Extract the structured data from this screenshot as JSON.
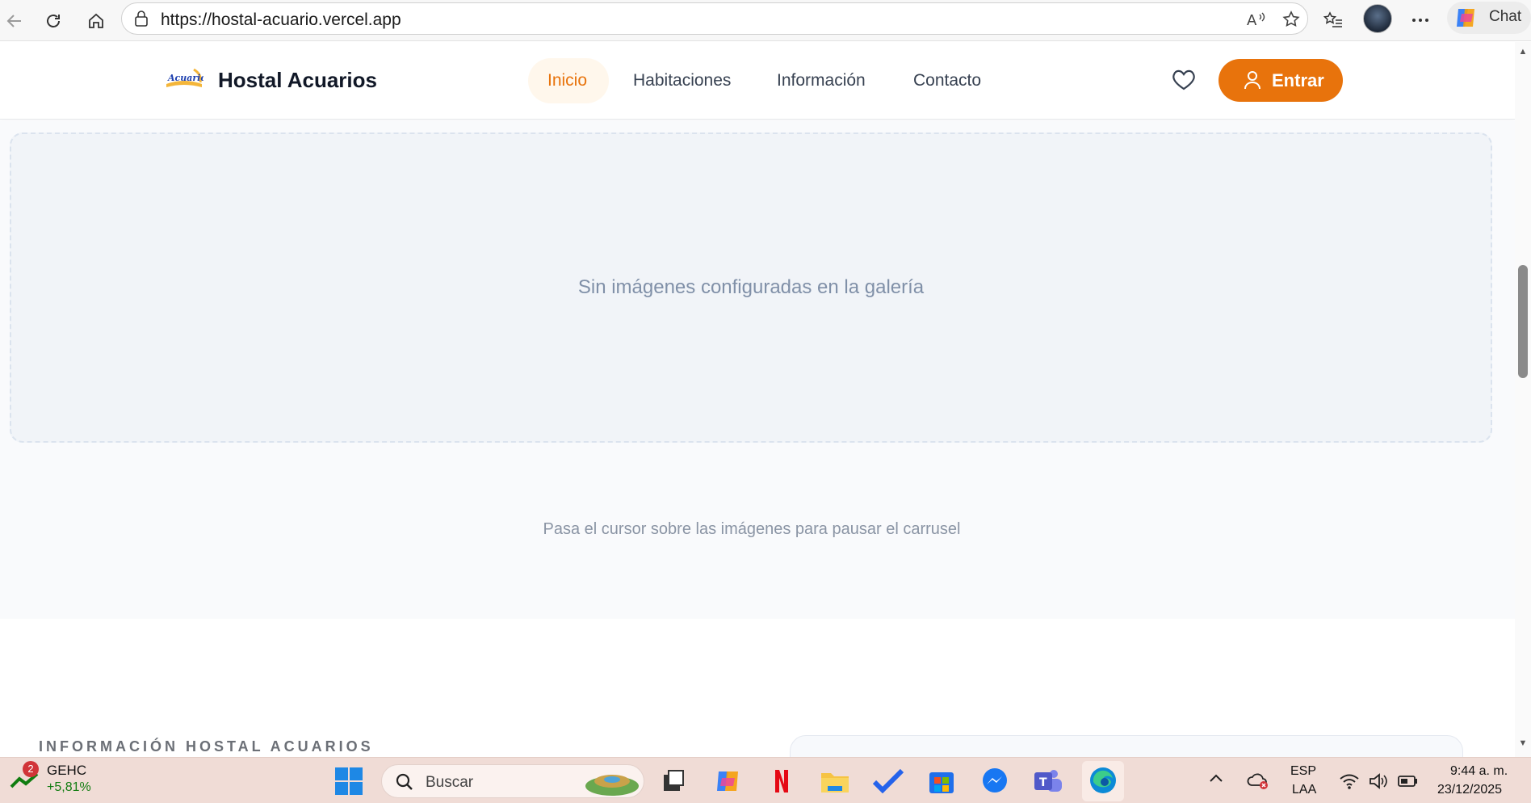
{
  "browser": {
    "url": "https://hostal-acuario.vercel.app",
    "chat_label": "Chat"
  },
  "site": {
    "logo_text": "Acuario",
    "brand": "Hostal Acuarios",
    "nav": [
      {
        "label": "Inicio",
        "active": true
      },
      {
        "label": "Habitaciones",
        "active": false
      },
      {
        "label": "Información",
        "active": false
      },
      {
        "label": "Contacto",
        "active": false
      }
    ],
    "enter_label": "Entrar",
    "accent_color": "#e8730c"
  },
  "gallery": {
    "empty_message": "Sin imágenes configuradas en la galería",
    "hint": "Pasa el cursor sobre las imágenes para pausar el carrusel"
  },
  "info": {
    "heading": "INFORMACIÓN HOSTAL ACUARIOS"
  },
  "taskbar": {
    "stock_badge": "2",
    "stock_name": "GEHC",
    "stock_change": "+5,81%",
    "search_placeholder": "Buscar",
    "lang_top": "ESP",
    "lang_bottom": "LAA",
    "time": "9:44 a. m.",
    "date": "23/12/2025"
  }
}
